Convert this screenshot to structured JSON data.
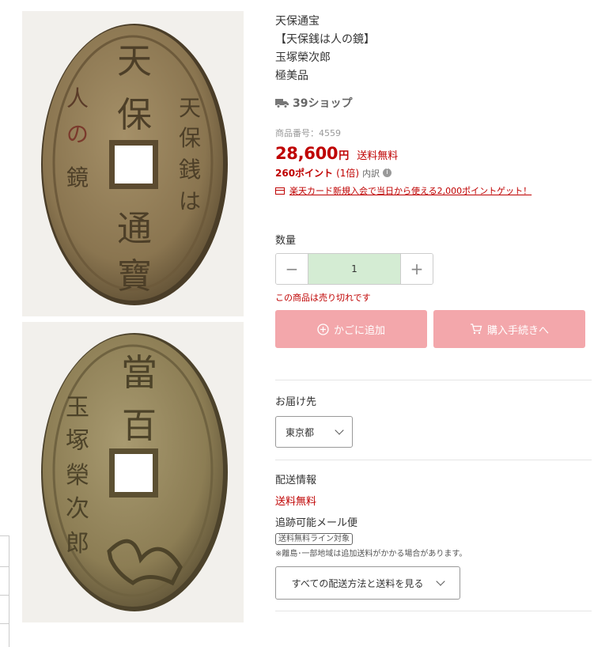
{
  "product": {
    "title": "天保通宝\n【天保銭は人の鏡】\n玉塚榮次郎\n極美品",
    "shop_name": "39ショップ",
    "item_number": "商品番号：4559",
    "price": "28,600",
    "currency": "円",
    "shipping_free": "送料無料",
    "points": "260ポイント",
    "points_multiplier": "(1倍)",
    "points_detail": "内訳",
    "card_promo": "楽天カード新規入会で当日から使える2,000ポイントゲット！",
    "accent_color": "#bf0000"
  },
  "quantity": {
    "label": "数量",
    "minus": "−",
    "value": "1",
    "plus": "+"
  },
  "purchase": {
    "soldout_text": "この商品は売り切れです",
    "add_to_cart": "かごに追加",
    "checkout": "購入手続きへ",
    "button_color": "#f3a7ab"
  },
  "delivery": {
    "label": "お届け先",
    "prefecture": "東京都"
  },
  "shipping": {
    "label": "配送情報",
    "free": "送料無料",
    "method": "追跡可能メール便",
    "badge": "送料無料ライン対象",
    "note": "※離島･一部地域は追加送料がかかる場合があります。",
    "all_methods": "すべての配送方法と送料を見る"
  },
  "images": {
    "front_inscription": [
      "天",
      "保",
      "通",
      "寶"
    ],
    "front_side_right": "天保銭は",
    "front_side_left": "人の鏡",
    "back_inscription": [
      "當",
      "百"
    ],
    "back_side": "玉塚榮次郎"
  }
}
